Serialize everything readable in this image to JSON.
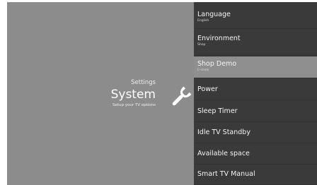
{
  "left": {
    "breadcrumb": "Settings",
    "title": "System",
    "subtitle": "Setup your TV options",
    "icon": "wrench-icon"
  },
  "menu": {
    "items": [
      {
        "label": "Language",
        "value": "English"
      },
      {
        "label": "Environment",
        "value": "Shop"
      },
      {
        "label": "Shop Demo",
        "value": "E-show"
      },
      {
        "label": "Power"
      },
      {
        "label": "Sleep Timer"
      },
      {
        "label": "Idle TV Standby"
      },
      {
        "label": "Available space"
      },
      {
        "label": "Smart TV Manual"
      }
    ],
    "selected_index": 2
  },
  "colors": {
    "left_panel": "#8c8c8c",
    "menu_bg": "#3a3a3a",
    "selected_bg": "#8f8f8f",
    "text": "#f4f4f4"
  }
}
